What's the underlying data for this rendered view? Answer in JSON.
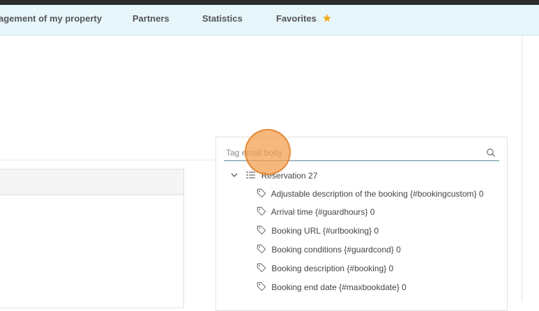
{
  "nav": {
    "items": [
      {
        "label": "agement of my property"
      },
      {
        "label": "Partners"
      },
      {
        "label": "Statistics"
      },
      {
        "label": "Favorites"
      }
    ],
    "favorites_icon": "star-icon",
    "accent_color": "#f2b01e"
  },
  "tag_panel": {
    "search": {
      "placeholder": "Tag email body",
      "value": ""
    },
    "root": {
      "label": "Reservation 27"
    },
    "tags": [
      {
        "label": "Adjustable description of the booking {#bookingcustom} 0"
      },
      {
        "label": "Arrival time {#guardhours} 0"
      },
      {
        "label": "Booking URL {#urlbooking} 0"
      },
      {
        "label": "Booking conditions {#guardcond} 0"
      },
      {
        "label": "Booking description {#booking} 0"
      },
      {
        "label": "Booking end date {#maxbookdate} 0"
      }
    ]
  }
}
